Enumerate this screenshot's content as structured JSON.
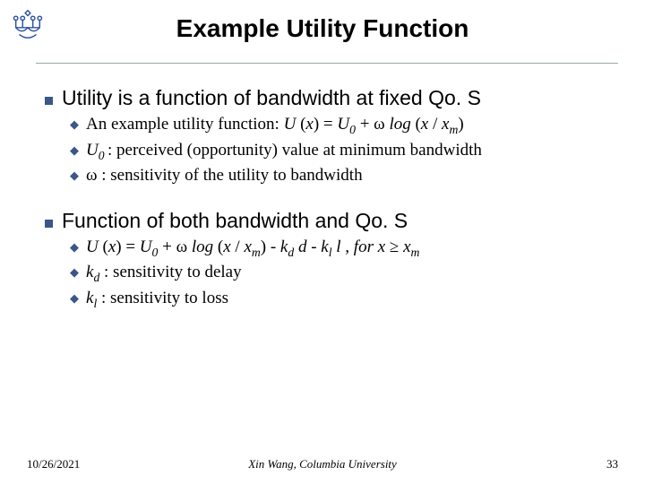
{
  "title": "Example Utility Function",
  "b1": {
    "heading": "Utility is a function of bandwidth at fixed Qo. S",
    "sub1_pre": "An example utility function: ",
    "sub1_post": "",
    "sub2_pre": "",
    "sub2_post": ": perceived (opportunity) value at minimum bandwidth",
    "sub3_pre": "ω : sensitivity of the utility to bandwidth"
  },
  "b2": {
    "heading": "Function of both bandwidth and Qo. S",
    "sub1_post": "",
    "sub2_post": " : sensitivity to delay",
    "sub3_post": " :  sensitivity to loss"
  },
  "math": {
    "eq1": "U (x) = U₀ + ω log (x / xₘ)",
    "U0": "U₀",
    "eq2": "U (x) = U₀ + ω log (x / xₘ) - k_d d - k_l l , for x ≥ xₘ",
    "kd": "k_d",
    "kl": "k_l"
  },
  "footer": {
    "date": "10/26/2021",
    "center": "Xin Wang, Columbia University",
    "page": "33"
  }
}
